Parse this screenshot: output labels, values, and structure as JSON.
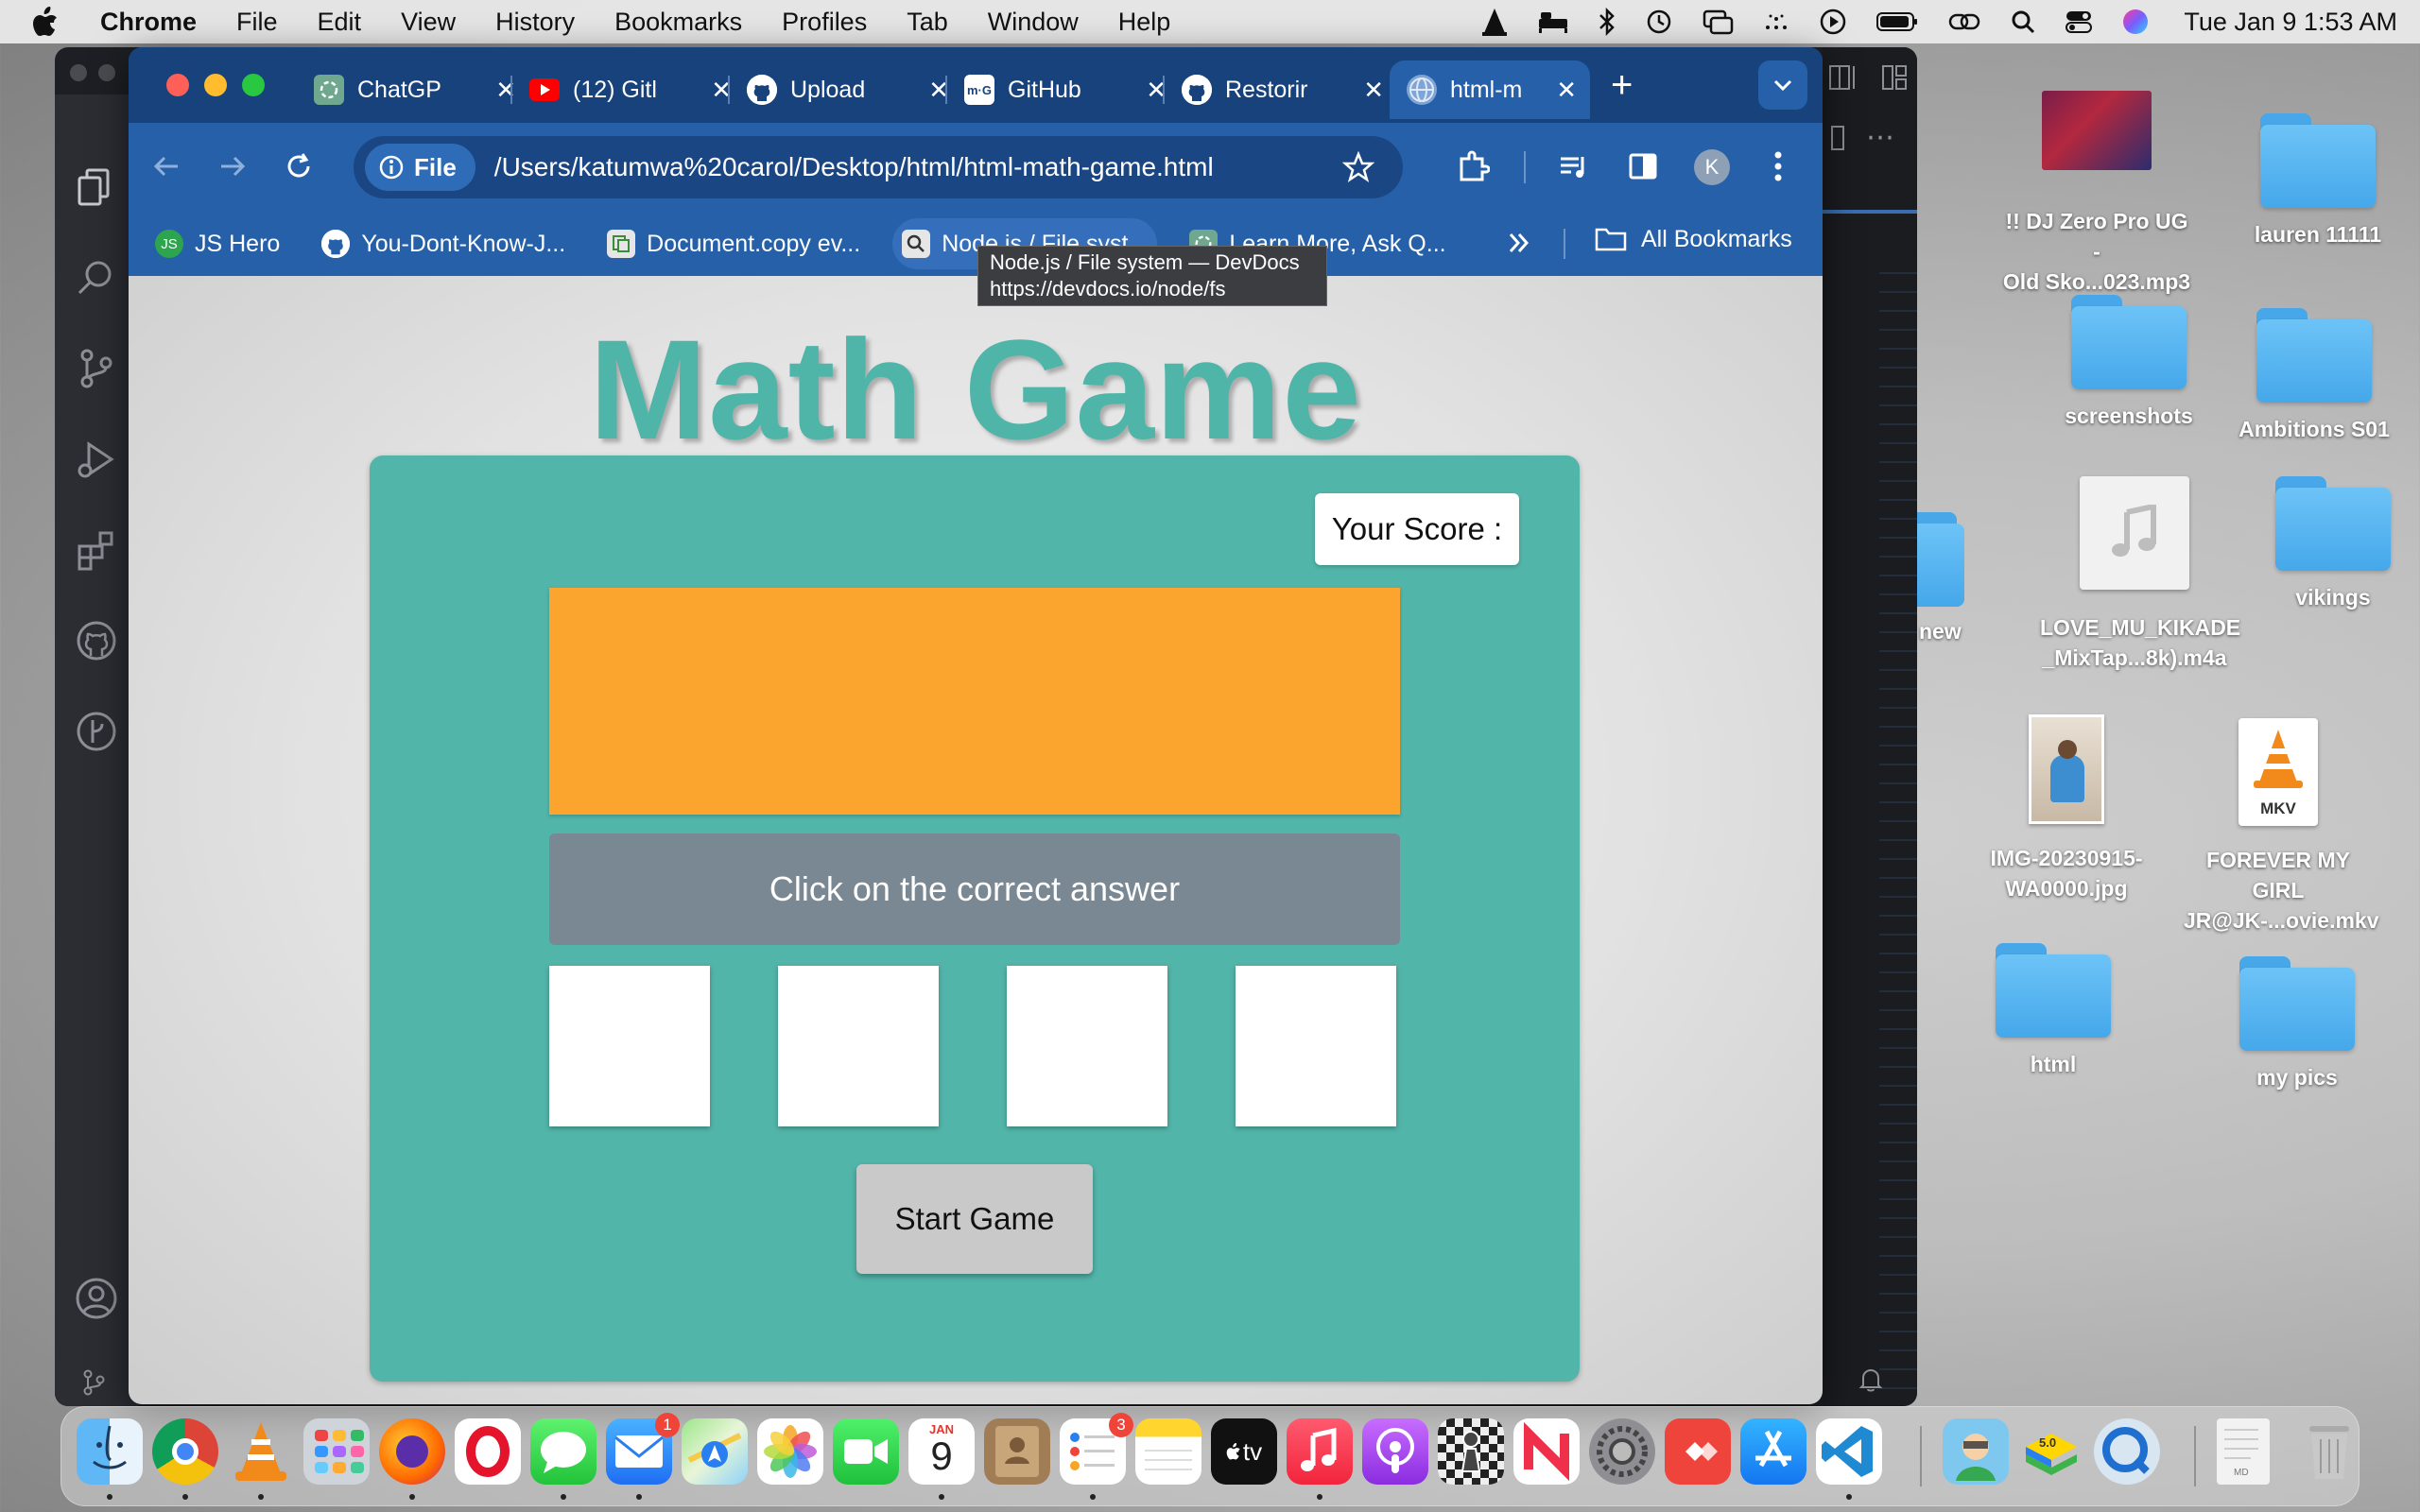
{
  "menubar": {
    "app_name": "Chrome",
    "items": [
      "File",
      "Edit",
      "View",
      "History",
      "Bookmarks",
      "Profiles",
      "Tab",
      "Window",
      "Help"
    ],
    "clock": "Tue Jan 9  1:53 AM"
  },
  "desktop": {
    "items": [
      {
        "label": "!! DJ Zero Pro UG - Old Sko...023.mp3",
        "line1": "!! DJ Zero Pro UG -",
        "line2": "Old Sko...023.mp3",
        "kind": "image"
      },
      {
        "label": "lauren 11111",
        "kind": "folder"
      },
      {
        "label": "screenshots",
        "kind": "folder"
      },
      {
        "label": "Ambitions S01",
        "kind": "folder"
      },
      {
        "label": "new",
        "kind": "folder"
      },
      {
        "label": "LOVE_MU_KIKADE_MixTap...8k).m4a",
        "line1": "LOVE_MU_KIKADE",
        "line2": "_MixTap...8k).m4a",
        "kind": "audio"
      },
      {
        "label": "vikings",
        "kind": "folder"
      },
      {
        "label": "IMG-20230915-WA0000.jpg",
        "line1": "IMG-20230915-",
        "line2": "WA0000.jpg",
        "kind": "image"
      },
      {
        "label": "FOREVER MY GIRL JR@JK-...ovie.mkv",
        "line1": "FOREVER MY GIRL",
        "line2": "JR@JK-...ovie.mkv",
        "kind": "video",
        "badge": "MKV"
      },
      {
        "label": "html",
        "kind": "folder"
      },
      {
        "label": "my pics",
        "kind": "folder"
      }
    ]
  },
  "browser": {
    "tabs": [
      {
        "label": "ChatGP",
        "icon": "chatgpt-icon"
      },
      {
        "label": "(12) Gitl",
        "icon": "youtube-icon"
      },
      {
        "label": "Upload",
        "icon": "github-icon"
      },
      {
        "label": "GitHub",
        "icon": "mg-icon"
      },
      {
        "label": "Restorir",
        "icon": "github-icon"
      },
      {
        "label": "html-m",
        "icon": "globe-icon",
        "active": true
      }
    ],
    "address": {
      "scheme_chip": "File",
      "url": "/Users/katumwa%20carol/Desktop/html/html-math-game.html"
    },
    "profile_initial": "K",
    "bookmarks": [
      {
        "label": "JS Hero",
        "icon": "jshero-icon"
      },
      {
        "label": "You-Dont-Know-J...",
        "icon": "github-icon"
      },
      {
        "label": "Document.copy ev...",
        "icon": "document-icon"
      },
      {
        "label": "Node.js / File syst...",
        "icon": "devdocs-icon"
      },
      {
        "label": "Learn More, Ask Q...",
        "icon": "chatgpt-icon"
      }
    ],
    "all_bookmarks": "All Bookmarks",
    "tooltip": {
      "title": "Node.js / File system — DevDocs",
      "url": "https://devdocs.io/node/fs"
    }
  },
  "game": {
    "title": "Math Game",
    "score_label": "Your Score :",
    "instruction": "Click on the correct answer",
    "start_button": "Start Game"
  },
  "dock": {
    "apps": [
      "Finder",
      "Chrome",
      "VLC",
      "Launchpad",
      "Firefox",
      "Opera",
      "Messages",
      "Mail",
      "Maps",
      "Photos",
      "FaceTime",
      "Calendar",
      "Contacts",
      "Reminders",
      "Notes",
      "TV",
      "Music",
      "Podcasts",
      "Chess",
      "News",
      "System Settings",
      "AnyDesk",
      "App Store",
      "VS Code",
      "Preview",
      "BlueStacks",
      "QuickTime",
      "Document",
      "Trash"
    ],
    "mail_badge": "1",
    "reminders_badge": "3",
    "calendar_month": "JAN",
    "calendar_day": "9",
    "tv_label": "tv",
    "bluestacks_label": "5.0",
    "file_label": "MD"
  },
  "colors": {
    "game_title": "#4fb5a8",
    "game_container": "#52b5a9",
    "question_box": "#fba52e",
    "instruction_box": "#7a8893",
    "chrome_frame": "#2560a8"
  }
}
